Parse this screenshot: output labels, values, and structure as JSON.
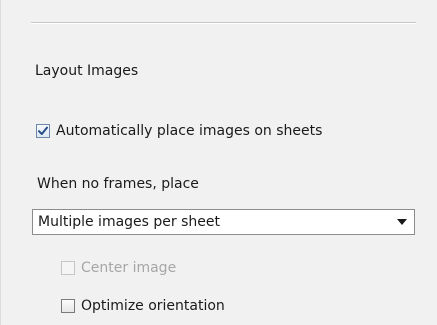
{
  "section": {
    "title": "Layout Images"
  },
  "auto_place": {
    "label": "Automatically place images on sheets",
    "checked": true
  },
  "no_frames": {
    "label": "When no frames, place"
  },
  "placement_select": {
    "value": "Multiple images per sheet",
    "icon": "chevron-down-icon"
  },
  "center_image": {
    "label": "Center image",
    "checked": false,
    "disabled": true
  },
  "optimize_orientation": {
    "label": "Optimize orientation",
    "checked": false
  },
  "colors": {
    "panel_background": "#f1f1f1",
    "disabled_text": "#a6a6a6",
    "checkmark": "#2a4f86"
  }
}
